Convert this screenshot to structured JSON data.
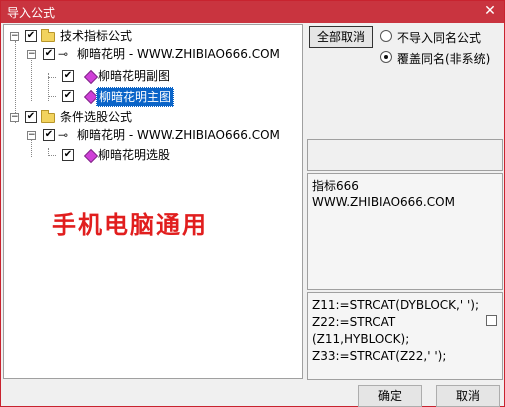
{
  "window": {
    "title": "导入公式",
    "close_glyph": "✕"
  },
  "tree": {
    "group1": {
      "label": "技术指标公式",
      "child": {
        "label": "柳暗花明 - WWW.ZHIBIAO666.COM",
        "items": [
          {
            "label": "柳暗花明副图",
            "selected": false
          },
          {
            "label": "柳暗花明主图",
            "selected": true
          }
        ]
      }
    },
    "group2": {
      "label": "条件选股公式",
      "child": {
        "label": "柳暗花明 - WWW.ZHIBIAO666.COM",
        "items": [
          {
            "label": "柳暗花明选股",
            "selected": false
          }
        ]
      }
    },
    "check_glyph": "✔",
    "expander_glyph": "−",
    "key_glyph": "⊸"
  },
  "overlay_text": "手机电脑通用",
  "options": {
    "deselect_all_label": "全部取消",
    "radio_no_import_label": "不导入同名公式",
    "radio_overwrite_label": "覆盖同名(非系统)",
    "selected_radio": "overwrite"
  },
  "description": {
    "line1": "指标666",
    "line2": "WWW.ZHIBIAO666.COM"
  },
  "code_preview": {
    "lines": [
      "Z11:=STRCAT(DYBLOCK,' ');",
      "Z22:=STRCAT",
      "(Z11,HYBLOCK);",
      "Z33:=STRCAT(Z22,' ');"
    ]
  },
  "footer": {
    "ok_label": "确定",
    "cancel_label": "取消"
  }
}
